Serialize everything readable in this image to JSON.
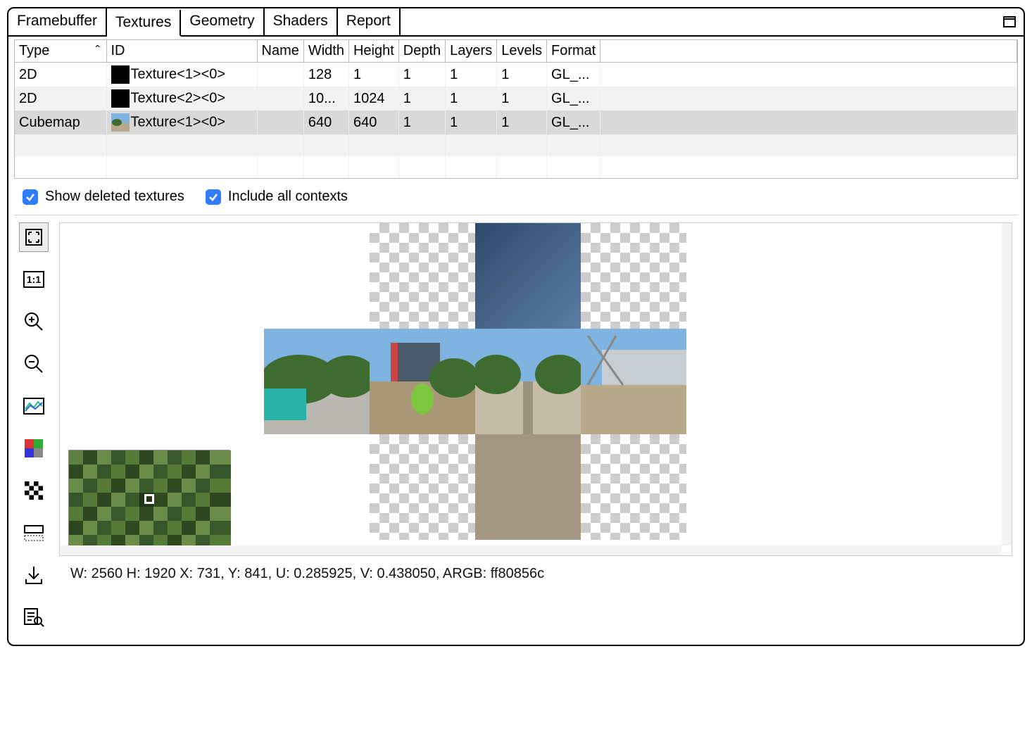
{
  "tabs": {
    "items": [
      "Framebuffer",
      "Textures",
      "Geometry",
      "Shaders",
      "Report"
    ],
    "active_index": 1
  },
  "table": {
    "headers": {
      "type": "Type",
      "id": "ID",
      "name": "Name",
      "width": "Width",
      "height": "Height",
      "depth": "Depth",
      "layers": "Layers",
      "levels": "Levels",
      "format": "Format"
    },
    "rows": [
      {
        "type": "2D",
        "id": "Texture<1><0>",
        "name": "",
        "width": "128",
        "height": "1",
        "depth": "1",
        "layers": "1",
        "levels": "1",
        "format": "GL_...",
        "thumb": "black"
      },
      {
        "type": "2D",
        "id": "Texture<2><0>",
        "name": "",
        "width": "10...",
        "height": "1024",
        "depth": "1",
        "layers": "1",
        "levels": "1",
        "format": "GL_...",
        "thumb": "black"
      },
      {
        "type": "Cubemap",
        "id": "Texture<1><0>",
        "name": "",
        "width": "640",
        "height": "640",
        "depth": "1",
        "layers": "1",
        "levels": "1",
        "format": "GL_...",
        "thumb": "img",
        "selected": true
      }
    ]
  },
  "checks": {
    "show_deleted": "Show deleted textures",
    "include_all": "Include all contexts"
  },
  "toolbar": {
    "fit": "fit-to-view-icon",
    "actual": "actual-size-icon",
    "zoom_in": "zoom-in-icon",
    "zoom_out": "zoom-out-icon",
    "histogram": "histogram-icon",
    "channels": "color-channels-icon",
    "alpha": "alpha-bg-icon",
    "flip": "flip-icon",
    "save": "save-icon",
    "inspect": "inspect-icon"
  },
  "status": {
    "text": "W: 2560 H: 1920   X: 731, Y: 841, U: 0.285925, V: 0.438050, ARGB: ff80856c"
  }
}
